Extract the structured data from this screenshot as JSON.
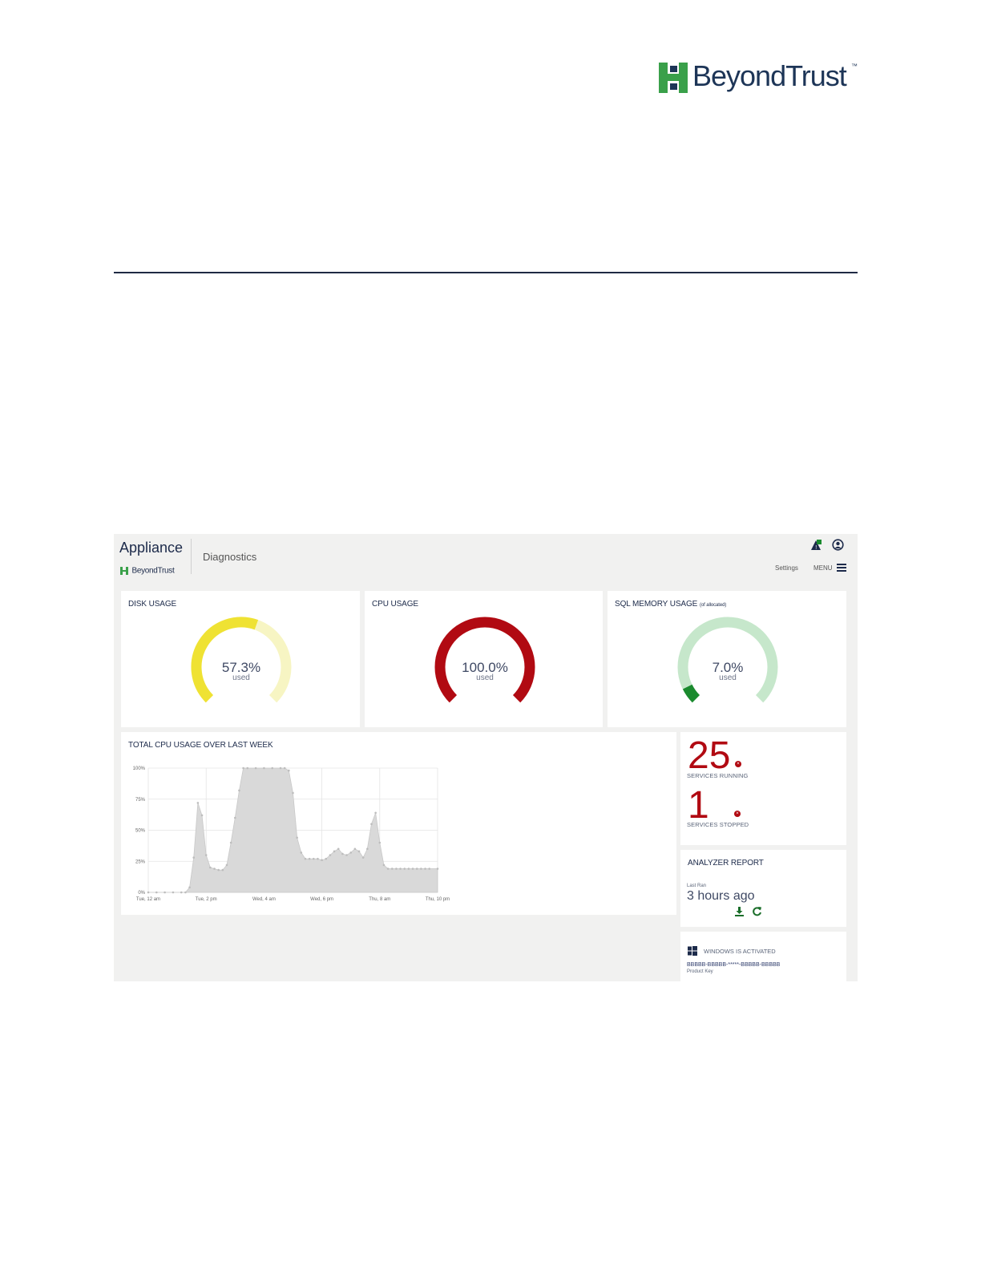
{
  "document": {
    "brand": "BeyondTrust",
    "trademark": "™"
  },
  "app": {
    "title": "Appliance",
    "sublogo": "BeyondTrust",
    "section": "Diagnostics",
    "settings_label": "Settings",
    "menu_label": "MENU",
    "status_badge": "!"
  },
  "gauges": [
    {
      "title": "DISK USAGE",
      "value_text": "57.3%",
      "sub": "used",
      "value": 57.3,
      "color": "#efe233",
      "track": "#f7f5c3"
    },
    {
      "title": "CPU USAGE",
      "value_text": "100.0%",
      "sub": "used",
      "value": 100.0,
      "color": "#b10a12",
      "track": "#f0c7c7"
    },
    {
      "title": "SQL MEMORY USAGE",
      "title_note": "(of allocated)",
      "value_text": "7.0%",
      "sub": "used",
      "value": 7.0,
      "color": "#1a8a2e",
      "track": "#c6e7cb"
    }
  ],
  "chart": {
    "title": "TOTAL CPU USAGE OVER LAST WEEK"
  },
  "chart_data": {
    "type": "area",
    "title": "TOTAL CPU USAGE OVER LAST WEEK",
    "xlabel": "",
    "ylabel": "",
    "ylim": [
      0,
      100
    ],
    "y_ticks": [
      "0%",
      "25%",
      "50%",
      "75%",
      "100%"
    ],
    "x_ticks": [
      "Tue, 12 am",
      "Tue, 2 pm",
      "Wed, 4 am",
      "Wed, 6 pm",
      "Thu, 8 am",
      "Thu, 10 pm"
    ],
    "x_range_hours": [
      0,
      70
    ],
    "grid": true,
    "color": "#d9d9d9",
    "x": [
      0,
      2,
      4,
      6,
      8,
      9,
      10,
      11,
      12,
      13,
      14,
      15,
      16,
      17,
      18,
      19,
      20,
      21,
      22,
      23,
      24,
      26,
      28,
      30,
      32,
      33,
      34,
      35,
      36,
      37,
      38,
      39,
      40,
      41,
      42,
      43,
      44,
      45,
      46,
      47,
      48,
      49,
      50,
      51,
      52,
      53,
      54,
      55,
      56,
      57,
      58,
      59,
      60,
      61,
      62,
      63,
      64,
      65,
      66,
      67,
      68,
      70
    ],
    "y": [
      0,
      0,
      0,
      0,
      0,
      0,
      4,
      28,
      72,
      62,
      30,
      20,
      19,
      18,
      18,
      22,
      40,
      60,
      82,
      100,
      100,
      100,
      100,
      100,
      100,
      100,
      98,
      80,
      44,
      32,
      27,
      27,
      27,
      27,
      26,
      27,
      30,
      33,
      35,
      31,
      30,
      32,
      35,
      33,
      28,
      35,
      55,
      64,
      40,
      22,
      19,
      19,
      19,
      19,
      19,
      19,
      19,
      19,
      19,
      19,
      19,
      19
    ]
  },
  "services": {
    "running_count": "25",
    "running_label": "SERVICES RUNNING",
    "stopped_count": "1",
    "stopped_label": "SERVICES STOPPED",
    "badge": "×"
  },
  "analyzer": {
    "title": "ANALYZER REPORT",
    "last_ran_label": "Last Ran",
    "last_ran_value": "3 hours ago"
  },
  "windows": {
    "status": "WINDOWS IS ACTIVATED",
    "product_key": "BBBBB-BBBBB-*****-BBBBB-BBBBB",
    "product_key_label": "Product Key"
  }
}
